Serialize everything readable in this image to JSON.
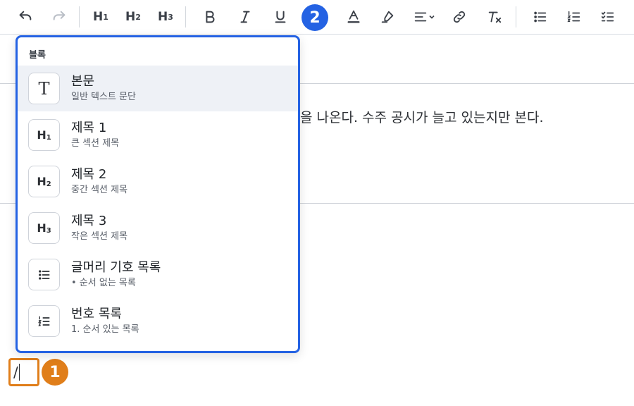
{
  "toolbar": {
    "h1": "H",
    "h1_sub": "1",
    "h2": "H",
    "h2_sub": "2",
    "h3": "H",
    "h3_sub": "3"
  },
  "document": {
    "visible_text": "을 나온다. 수주 공시가 늘고 있는지만 본다."
  },
  "slash_input": {
    "value": "/"
  },
  "badges": {
    "one": "1",
    "two": "2"
  },
  "menu": {
    "heading": "블록",
    "items": [
      {
        "icon": "T",
        "icon_sub": "",
        "title": "본문",
        "desc": "일반 텍스트 문단"
      },
      {
        "icon": "H",
        "icon_sub": "1",
        "title": "제목 1",
        "desc": "큰 섹션 제목"
      },
      {
        "icon": "H",
        "icon_sub": "2",
        "title": "제목 2",
        "desc": "중간 섹션 제목"
      },
      {
        "icon": "H",
        "icon_sub": "3",
        "title": "제목 3",
        "desc": "작은 섹션 제목"
      },
      {
        "icon": "bullet-list",
        "icon_sub": "",
        "title": "글머리 기호 목록",
        "desc": "• 순서 없는 목록"
      },
      {
        "icon": "numbered-list",
        "icon_sub": "",
        "title": "번호 목록",
        "desc": "1. 순서 있는 목록"
      }
    ]
  },
  "colors": {
    "accent_blue": "#2462e3",
    "accent_orange": "#e07e1a",
    "active_row": "#eef1f6"
  }
}
